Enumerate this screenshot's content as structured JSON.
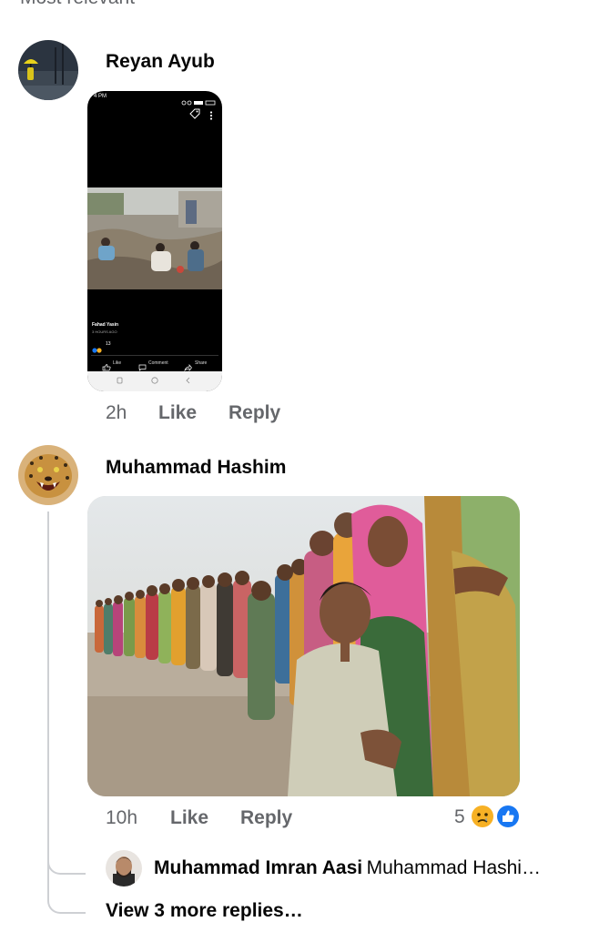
{
  "header": {
    "sort_label": "Most relevant"
  },
  "comments": [
    {
      "author": "Reyan Ayub",
      "time": "2h",
      "like_label": "Like",
      "reply_label": "Reply",
      "screenshot": {
        "status_time": "4 PM",
        "post_author": "Fahad Yasin",
        "post_time": "3 HOURS AGO",
        "reaction_count": "13",
        "actions": [
          "Like",
          "Comment",
          "Share"
        ]
      }
    },
    {
      "author": "Muhammad Hashim",
      "time": "10h",
      "like_label": "Like",
      "reply_label": "Reply",
      "reaction_count": "5",
      "reactions": [
        "sad-reaction-icon",
        "like-reaction-icon"
      ]
    }
  ],
  "reply": {
    "author": "Muhammad Imran Aasi",
    "text_preview": "Muhammad Hashi…"
  },
  "view_more": "View 3 more replies…",
  "colors": {
    "secondary_text": "#65676b",
    "thread_line": "#ced0d4",
    "like_blue": "#1877f2",
    "sad_yellow": "#f7b125"
  }
}
